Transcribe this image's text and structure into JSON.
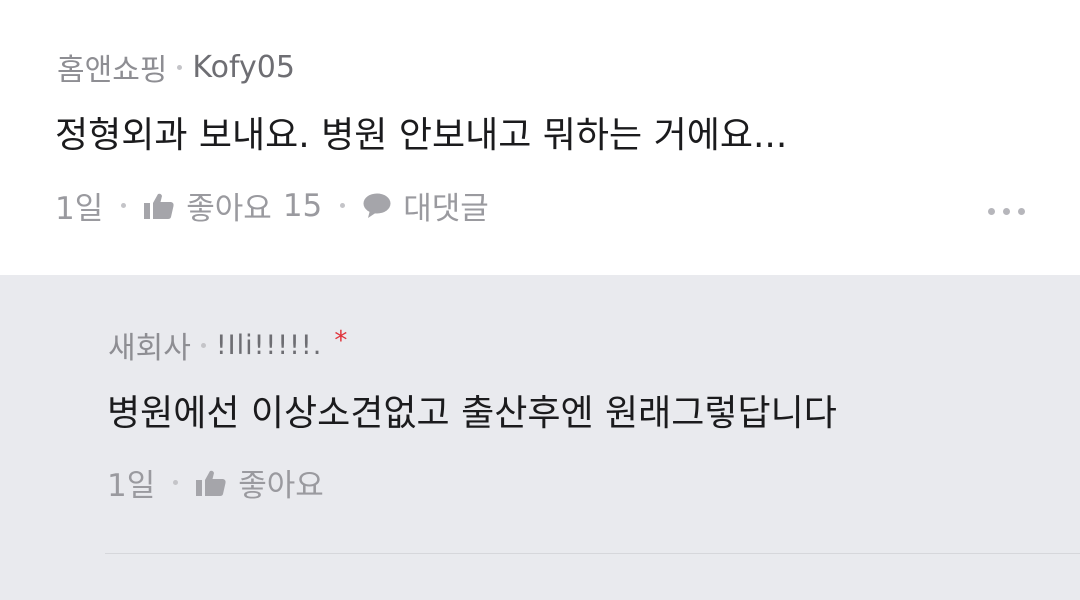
{
  "comment": {
    "category": "홈앤쇼핑",
    "nickname": "Kofy05",
    "text": "정형외과 보내요. 병원 안보내고 뭐하는 거에요...",
    "time": "1일",
    "like_label": "좋아요",
    "like_count": "15",
    "reply_label": "대댓글",
    "more_icon": "more-horizontal-icon"
  },
  "reply": {
    "category": "새회사",
    "nickname": "!Ili!!!!!.",
    "author_mark": "*",
    "text": "병원에선 이상소견없고 출산후엔 원래그렇답니다",
    "time": "1일",
    "like_label": "좋아요"
  },
  "colors": {
    "reply_background": "#e9eaee",
    "author_mark": "#e0323a",
    "meta_text": "#9a9a9f",
    "body_text": "#1b1b1d"
  }
}
